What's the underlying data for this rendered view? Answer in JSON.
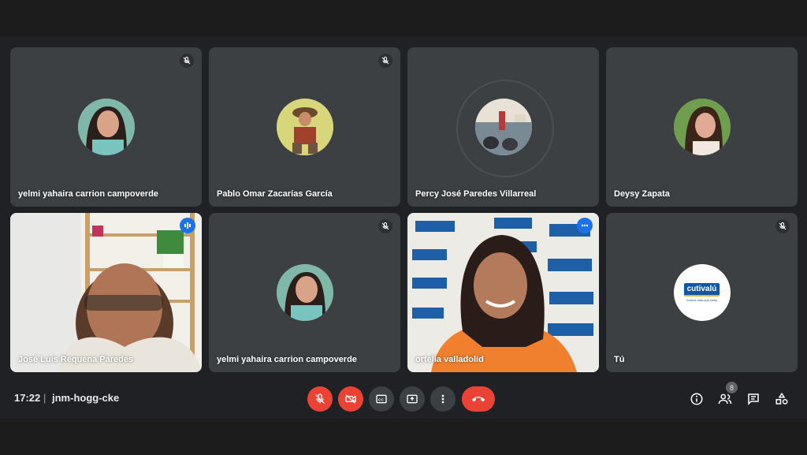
{
  "participants": [
    {
      "name": "yelmi yahaira carrion campoverde"
    },
    {
      "name": "Pablo Omar Zacarías García"
    },
    {
      "name": "Percy José Paredes Villarreal"
    },
    {
      "name": "Deysy Zapata"
    },
    {
      "name": "José Luis Requena Paredes"
    },
    {
      "name": "yelmi yahaira carrion campoverde"
    },
    {
      "name": "ortelia valladolid"
    },
    {
      "name": "Tú"
    }
  ],
  "self_logo": {
    "brand": "cutivalú",
    "tagline": "Somos más que radio"
  },
  "meeting": {
    "time": "17:22",
    "separator": "|",
    "code": "jnm-hogg-cke"
  },
  "people_count": "8",
  "colors": {
    "accent": "#1a73e8",
    "danger": "#ea4335",
    "tile": "#3c4043"
  },
  "icons": {
    "tile_status": "mic-off-icon",
    "controls": [
      "mic-off-icon",
      "camera-off-icon",
      "captions-icon",
      "present-icon",
      "more-vert-icon",
      "hangup-icon"
    ],
    "right_controls": [
      "info-icon",
      "people-icon",
      "chat-icon",
      "activities-icon"
    ]
  }
}
